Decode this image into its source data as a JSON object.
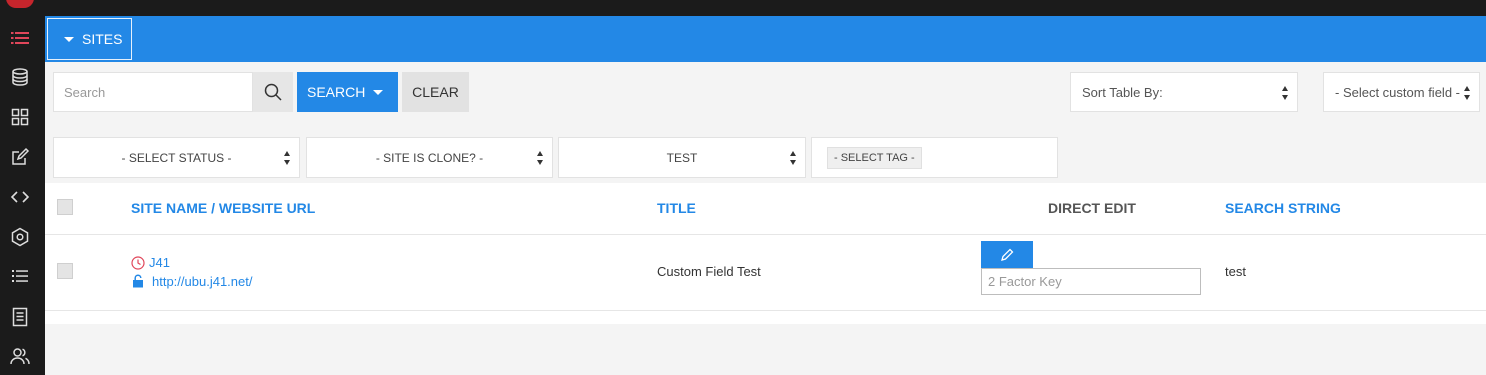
{
  "header": {
    "sites_label": "SITES"
  },
  "sidebar": {
    "icons": [
      "list-icon",
      "database-icon",
      "grid-icon",
      "edit-icon",
      "code-icon",
      "hexagon-icon",
      "bullet-list-icon",
      "document-icon",
      "users-icon"
    ]
  },
  "toolbar": {
    "search_placeholder": "Search",
    "search_button": "SEARCH",
    "clear_button": "CLEAR",
    "sort_label": "Sort Table By:",
    "custom_field_label": "- Select custom field -"
  },
  "filters": {
    "status": "- SELECT STATUS -",
    "clone": "- SITE IS CLONE? -",
    "test": "TEST",
    "tag": "- SELECT TAG -"
  },
  "table": {
    "columns": {
      "site_name": "SITE NAME",
      "separator": "/",
      "website_url": "WEBSITE URL",
      "title": "TITLE",
      "direct_edit": "DIRECT EDIT",
      "search_string": "SEARCH STRING"
    },
    "rows": [
      {
        "site_name": "J41",
        "url": "http://ubu.j41.net/",
        "title": "Custom Field Test",
        "two_factor_placeholder": "2 Factor Key",
        "search_string": "test"
      }
    ]
  },
  "colors": {
    "accent": "#2388e6",
    "sidebar": "#1b1b1b",
    "clock": "#e0465a"
  }
}
